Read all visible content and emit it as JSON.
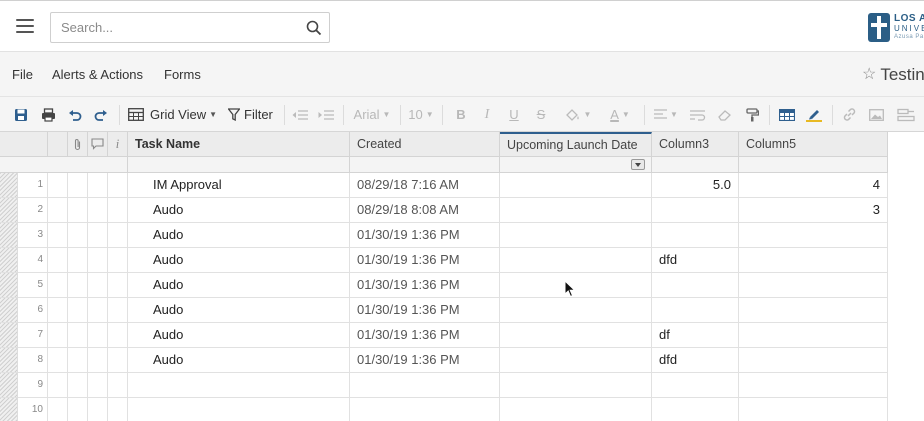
{
  "header": {
    "search_placeholder": "Search...",
    "logo": {
      "line1": "LOS A",
      "line2": "UNIVE",
      "line3": "Azusa Pa"
    }
  },
  "menu": {
    "items": [
      "File",
      "Alerts & Actions",
      "Forms"
    ],
    "sheet_title": "Testin"
  },
  "toolbar": {
    "grid_view_label": "Grid View",
    "filter_label": "Filter",
    "font_label": "Arial",
    "font_size_label": "10",
    "bold_label": "B",
    "italic_label": "I",
    "underline_label": "U",
    "strike_label": "S",
    "text_color_label": "A"
  },
  "grid": {
    "info_header": "i",
    "columns": [
      "Task Name",
      "Created",
      "Upcoming Launch Date",
      "Column3",
      "Column5"
    ],
    "rows": [
      {
        "num": "1",
        "task": "IM Approval",
        "created": "08/29/18 7:16 AM",
        "launch": "",
        "col3": "5.0",
        "col5": "4"
      },
      {
        "num": "2",
        "task": "Audo",
        "created": "08/29/18 8:08 AM",
        "launch": "",
        "col3": "",
        "col5": "3"
      },
      {
        "num": "3",
        "task": "Audo",
        "created": "01/30/19 1:36 PM",
        "launch": "",
        "col3": "",
        "col5": ""
      },
      {
        "num": "4",
        "task": "Audo",
        "created": "01/30/19 1:36 PM",
        "launch": "",
        "col3": "dfd",
        "col5": ""
      },
      {
        "num": "5",
        "task": "Audo",
        "created": "01/30/19 1:36 PM",
        "launch": "",
        "col3": "",
        "col5": ""
      },
      {
        "num": "6",
        "task": "Audo",
        "created": "01/30/19 1:36 PM",
        "launch": "",
        "col3": "",
        "col5": ""
      },
      {
        "num": "7",
        "task": "Audo",
        "created": "01/30/19 1:36 PM",
        "launch": "",
        "col3": "df",
        "col5": ""
      },
      {
        "num": "8",
        "task": "Audo",
        "created": "01/30/19 1:36 PM",
        "launch": "",
        "col3": "dfd",
        "col5": ""
      },
      {
        "num": "9",
        "task": "",
        "created": "",
        "launch": "",
        "col3": "",
        "col5": ""
      },
      {
        "num": "10",
        "task": "",
        "created": "",
        "launch": "",
        "col3": "",
        "col5": ""
      }
    ]
  },
  "colors": {
    "accent": "#2f5f8e",
    "brand": "#2b5e86"
  }
}
